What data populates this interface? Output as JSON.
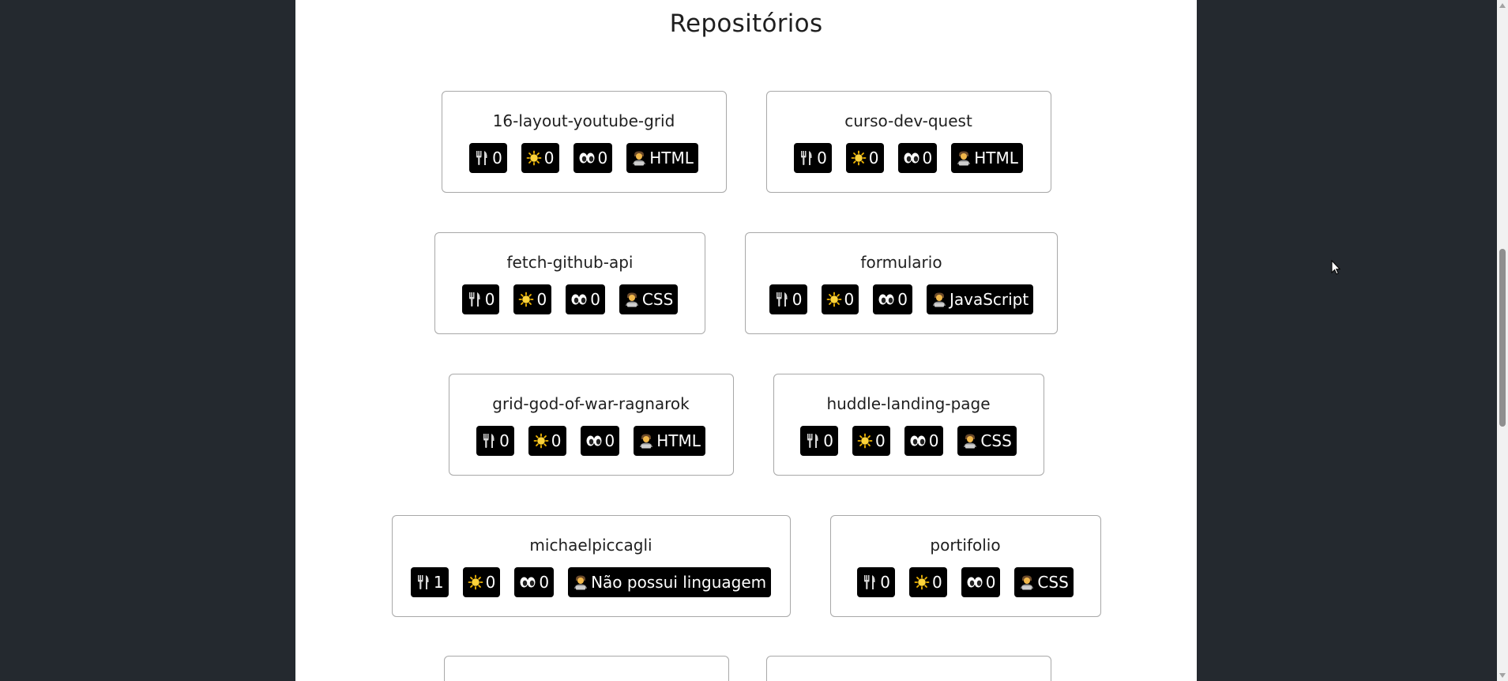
{
  "page": {
    "title": "Repositórios"
  },
  "repos": [
    {
      "name": "16-layout-youtube-grid",
      "forks": "0",
      "stars": "0",
      "watchers": "0",
      "language": "HTML"
    },
    {
      "name": "curso-dev-quest",
      "forks": "0",
      "stars": "0",
      "watchers": "0",
      "language": "HTML"
    },
    {
      "name": "fetch-github-api",
      "forks": "0",
      "stars": "0",
      "watchers": "0",
      "language": "CSS"
    },
    {
      "name": "formulario",
      "forks": "0",
      "stars": "0",
      "watchers": "0",
      "language": "JavaScript"
    },
    {
      "name": "grid-god-of-war-ragnarok",
      "forks": "0",
      "stars": "0",
      "watchers": "0",
      "language": "HTML"
    },
    {
      "name": "huddle-landing-page",
      "forks": "0",
      "stars": "0",
      "watchers": "0",
      "language": "CSS"
    },
    {
      "name": "michaelpiccagli",
      "forks": "1",
      "stars": "0",
      "watchers": "0",
      "language": "Não possui linguagem"
    },
    {
      "name": "portifolio",
      "forks": "0",
      "stars": "0",
      "watchers": "0",
      "language": "CSS"
    }
  ],
  "icons": {
    "forks": "fork-and-knife-icon",
    "stars": "sun-icon",
    "watchers": "eyes-icon",
    "language": "technologist-icon"
  },
  "colors": {
    "background": "#24292f",
    "panel": "#ffffff",
    "badge": "#000000",
    "badge_text": "#ffffff",
    "card_border": "#a8a8a8"
  }
}
